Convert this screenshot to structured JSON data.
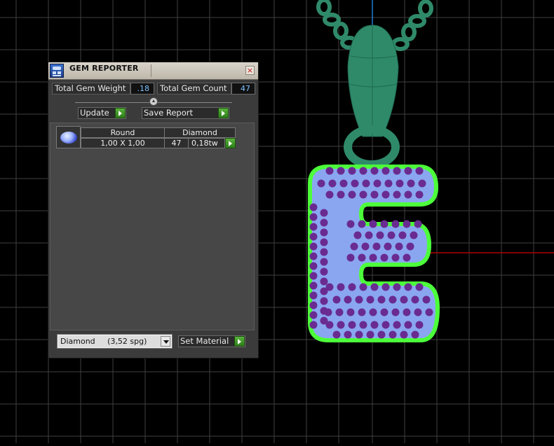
{
  "panel": {
    "title": "GEM REPORTER",
    "close_glyph": "×",
    "total_weight_label": "Total Gem Weight",
    "total_weight_value": ".18",
    "total_count_label": "Total Gem Count",
    "total_count_value": "47",
    "update_label": "Update",
    "save_report_label": "Save Report",
    "gems": [
      {
        "shape": "Round",
        "material": "Diamond",
        "size": "1,00 X 1,00",
        "count": "47",
        "weight": "0,18tw"
      }
    ],
    "material_select": {
      "value": "Diamond     (3,52 spg)"
    },
    "set_material_label": "Set Material"
  },
  "colors": {
    "viewport_bg": "#000000",
    "grid": "#3f3f3f",
    "pendant_green": "#2f8a6a",
    "outline_green": "#4cff3a",
    "letter_fill": "#8aa6f0",
    "gem_purple": "#6a2b91",
    "axis_red": "#b00000",
    "axis_blue": "#1e7ad6"
  },
  "icons": {
    "app": "gem-reporter-app-icon",
    "close": "close-icon",
    "go": "green-arrow-icon",
    "dropdown": "chevron-down-icon",
    "thumb": "round-diamond-icon"
  }
}
